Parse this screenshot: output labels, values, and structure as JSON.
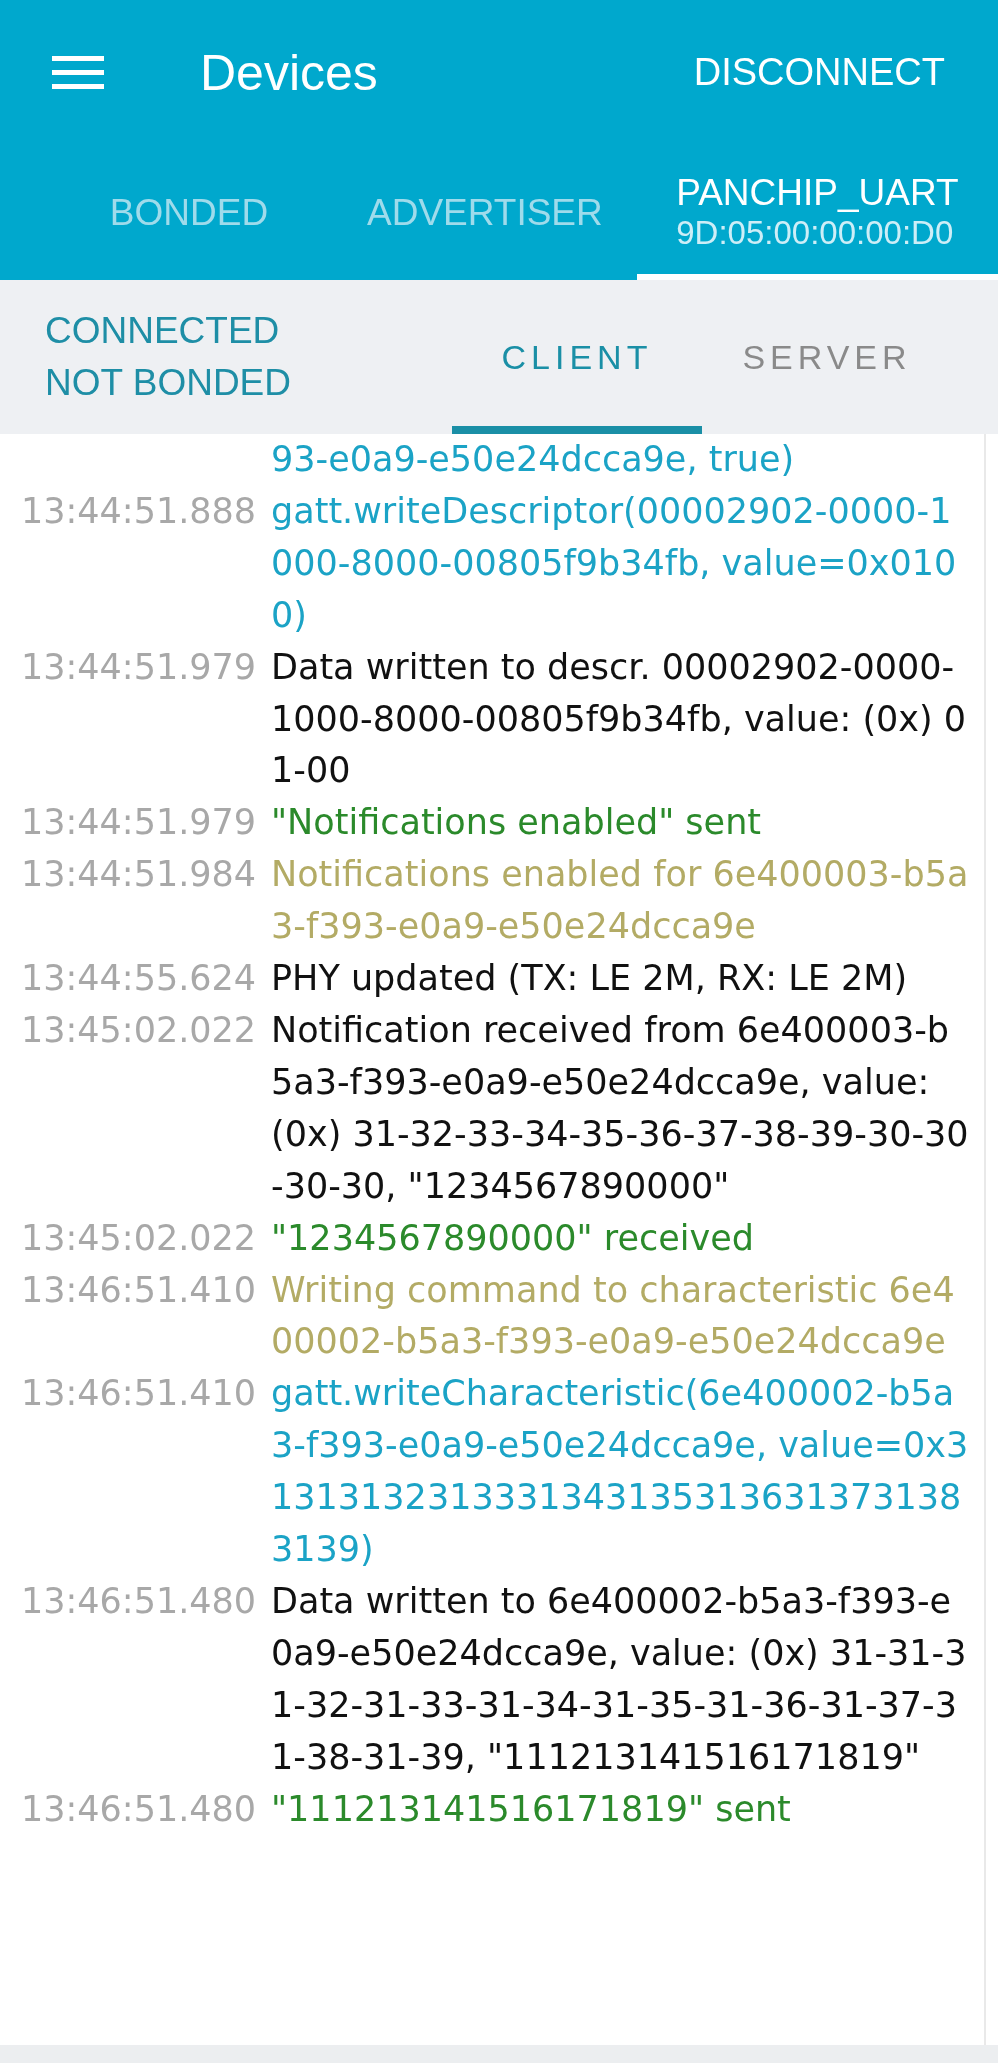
{
  "app_bar": {
    "title": "Devices",
    "action": "DISCONNECT"
  },
  "device_tabs": [
    {
      "label": "BONDED",
      "selected": false
    },
    {
      "label": "ADVERTISER",
      "selected": false
    },
    {
      "label": "PANCHIP_UART",
      "subtitle": "9D:05:00:00:00:D0",
      "selected": true
    }
  ],
  "connection": {
    "connection_state": "CONNECTED",
    "bond_state": "NOT BONDED"
  },
  "view_tabs": [
    {
      "label": "CLIENT",
      "selected": true
    },
    {
      "label": "SERVER",
      "selected": false
    }
  ],
  "log": [
    {
      "kind": "debug",
      "message": "93-e0a9-e50e24dcca9e, true)"
    },
    {
      "time": "13:44:51.888",
      "kind": "debug",
      "message": "gatt.writeDescriptor(00002902-0000-1000-8000-00805f9b34fb, value=0x0100)"
    },
    {
      "time": "13:44:51.979",
      "kind": "info",
      "message": "Data written to descr. 00002902-0000-1000-8000-00805f9b34fb, value: (0x) 01-00"
    },
    {
      "time": "13:44:51.979",
      "kind": "application",
      "message": "\"Notifications enabled\" sent"
    },
    {
      "time": "13:44:51.984",
      "kind": "verbose",
      "message": "Notifications enabled for 6e400003-b5a3-f393-e0a9-e50e24dcca9e"
    },
    {
      "time": "13:44:55.624",
      "kind": "info",
      "message": "PHY updated (TX: LE 2M, RX: LE 2M)"
    },
    {
      "time": "13:45:02.022",
      "kind": "info",
      "message": "Notification received from 6e400003-b5a3-f393-e0a9-e50e24dcca9e, value: (0x) 31-32-33-34-35-36-37-38-39-30-30-30-30, \"1234567890000\""
    },
    {
      "time": "13:45:02.022",
      "kind": "application",
      "message": "\"1234567890000\" received"
    },
    {
      "time": "13:46:51.410",
      "kind": "verbose",
      "message": "Writing command to characteristic 6e400002-b5a3-f393-e0a9-e50e24dcca9e"
    },
    {
      "time": "13:46:51.410",
      "kind": "debug",
      "message": "gatt.writeCharacteristic(6e400002-b5a3-f393-e0a9-e50e24dcca9e, value=0x313131323133313431353136313731383139)"
    },
    {
      "time": "13:46:51.480",
      "kind": "info",
      "message": "Data written to 6e400002-b5a3-f393-e0a9-e50e24dcca9e, value: (0x) 31-31-31-32-31-33-31-34-31-35-31-36-31-37-31-38-31-39, \"111213141516171819\""
    },
    {
      "time": "13:46:51.480",
      "kind": "application",
      "message": "\"111213141516171819\" sent"
    }
  ]
}
